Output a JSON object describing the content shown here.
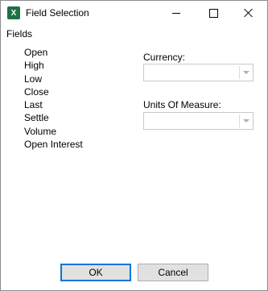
{
  "window": {
    "title": "Field Selection",
    "app_icon_letter": "X"
  },
  "fields": {
    "heading": "Fields",
    "items": [
      "Open",
      "High",
      "Low",
      "Close",
      "Last",
      "Settle",
      "Volume",
      "Open Interest"
    ]
  },
  "currency": {
    "label": "Currency:",
    "value": ""
  },
  "units_of_measure": {
    "label": "Units Of Measure:",
    "value": ""
  },
  "buttons": {
    "ok": "OK",
    "cancel": "Cancel"
  },
  "colors": {
    "accent": "#0078d7",
    "excel_green": "#1e7145"
  }
}
